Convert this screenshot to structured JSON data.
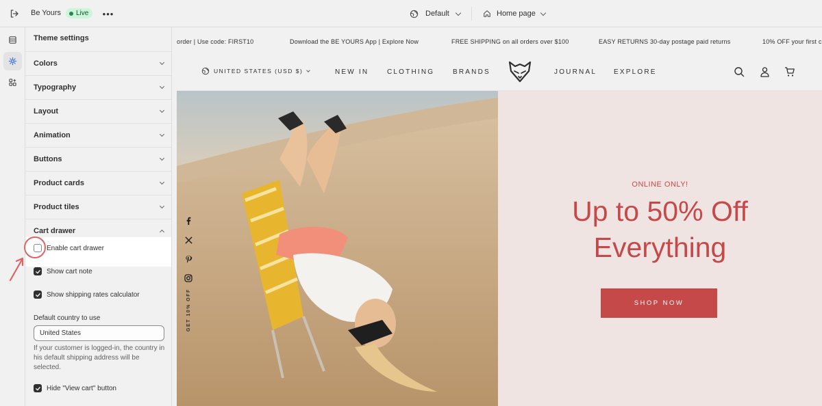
{
  "topbar": {
    "store_name": "Be Yours",
    "live_label": "Live",
    "theme_label": "Default",
    "page_label": "Home page",
    "colors": {
      "live_bg": "#cdf6d9",
      "live_dot": "#29845a"
    }
  },
  "rail": {
    "items": [
      {
        "icon": "sections-icon"
      },
      {
        "icon": "gear-icon",
        "active": true
      },
      {
        "icon": "apps-icon"
      }
    ]
  },
  "panel": {
    "title": "Theme settings",
    "sections": [
      {
        "label": "Colors"
      },
      {
        "label": "Typography"
      },
      {
        "label": "Layout"
      },
      {
        "label": "Animation"
      },
      {
        "label": "Buttons"
      },
      {
        "label": "Product cards"
      },
      {
        "label": "Product tiles"
      },
      {
        "label": "Cart drawer",
        "expanded": true
      }
    ],
    "cart_drawer": {
      "enable_label": "Enable cart drawer",
      "enable_checked": false,
      "cart_note_label": "Show cart note",
      "cart_note_checked": true,
      "shipping_calc_label": "Show shipping rates calculator",
      "shipping_calc_checked": true,
      "country_label": "Default country to use",
      "country_value": "United States",
      "country_help": "If your customer is logged-in, the country in his default shipping address will be selected.",
      "view_cart_label": "Hide \"View cart\" button",
      "view_cart_checked": true
    }
  },
  "preview": {
    "announcements": [
      "order | Use code: FIRST10",
      "Download the BE YOURS App | Explore Now",
      "FREE SHIPPING on all orders over $100",
      "EASY RETURNS 30-day postage paid returns",
      "10% OFF your first c"
    ],
    "nav": {
      "country": "UNITED STATES (USD $)",
      "links": [
        "NEW IN",
        "CLOTHING",
        "BRANDS",
        "JOURNAL",
        "EXPLORE"
      ]
    },
    "side_tab": "GET 10% OFF",
    "hero": {
      "eyebrow": "ONLINE ONLY!",
      "headline_line1": "Up to 50% Off",
      "headline_line2": "Everything",
      "button": "SHOP NOW",
      "accent": "#c6494a",
      "bg": "#f0e4e2"
    }
  }
}
